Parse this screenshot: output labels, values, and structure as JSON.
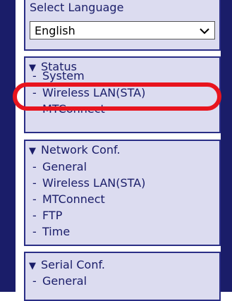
{
  "language": {
    "title": "Select Language",
    "selected": "English"
  },
  "status": {
    "title": "Status",
    "items": [
      "System",
      "Wireless LAN(STA)",
      "MTConnect"
    ]
  },
  "network": {
    "title": "Network Conf.",
    "items": [
      "General",
      "Wireless LAN(STA)",
      "MTConnect",
      "FTP",
      "Time"
    ]
  },
  "serial": {
    "title": "Serial Conf.",
    "items": [
      "General"
    ]
  },
  "glyphs": {
    "triangle": "▼",
    "dash": "-"
  },
  "colors": {
    "frame": "#1a1d69",
    "panel": "#dcdcf0",
    "highlight": "#e8141e"
  }
}
